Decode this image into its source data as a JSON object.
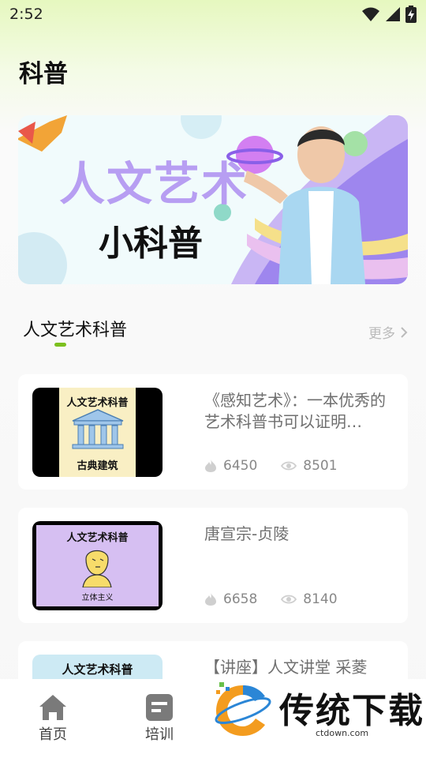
{
  "status_bar": {
    "time": "2:52",
    "icons": [
      "wifi-icon",
      "signal-icon",
      "battery-charging-icon"
    ]
  },
  "page": {
    "title": "科普"
  },
  "banner": {
    "title": "人文艺术",
    "subtitle": "小科普"
  },
  "section": {
    "title": "人文艺术科普",
    "more_label": "更多"
  },
  "articles": [
    {
      "title": "《感知艺术》：一本优秀的艺术科普书可以证明…",
      "thumb_header": "人文艺术科普",
      "thumb_caption": "古典建筑",
      "hot": "6450",
      "views": "8501"
    },
    {
      "title": "唐宣宗-贞陵",
      "thumb_header": "人文艺术科普",
      "thumb_caption": "立体主义",
      "hot": "6658",
      "views": "8140"
    },
    {
      "title": "【讲座】人文讲堂 采菱",
      "thumb_header": "人文艺术科普"
    }
  ],
  "bottom_nav": [
    {
      "label": "首页",
      "icon": "home-icon"
    },
    {
      "label": "培训",
      "icon": "training-icon"
    }
  ],
  "watermark": {
    "text": "传统下载",
    "url": "ctdown.com"
  },
  "colors": {
    "accent": "#7cc01e",
    "banner_title": "#b79ef2"
  }
}
